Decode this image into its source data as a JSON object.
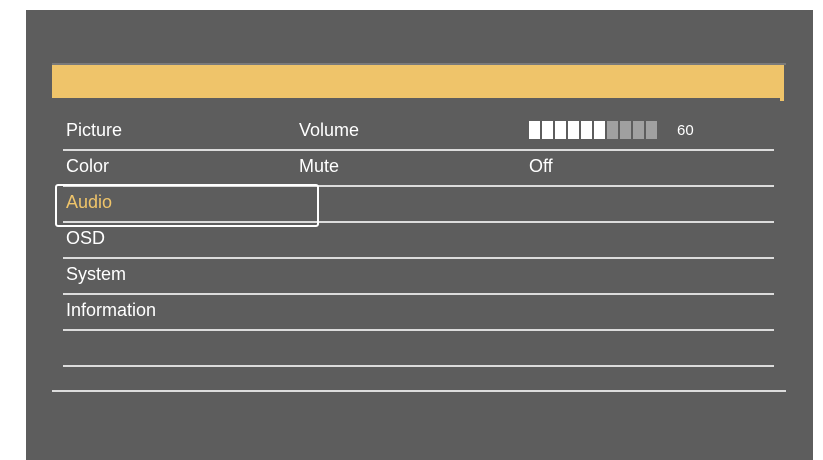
{
  "menu": {
    "categories": [
      {
        "label": "Picture"
      },
      {
        "label": "Color"
      },
      {
        "label": "Audio"
      },
      {
        "label": "OSD"
      },
      {
        "label": "System"
      },
      {
        "label": "Information"
      }
    ],
    "selected_index": 2
  },
  "audio_settings": {
    "rows": [
      {
        "label": "Volume",
        "value": "60"
      },
      {
        "label": "Mute",
        "value": "Off"
      }
    ],
    "volume_level_percent": 60
  },
  "colors": {
    "header_accent": "#efc46a",
    "selected_text": "#efc46a",
    "background": "#5d5d5d"
  }
}
